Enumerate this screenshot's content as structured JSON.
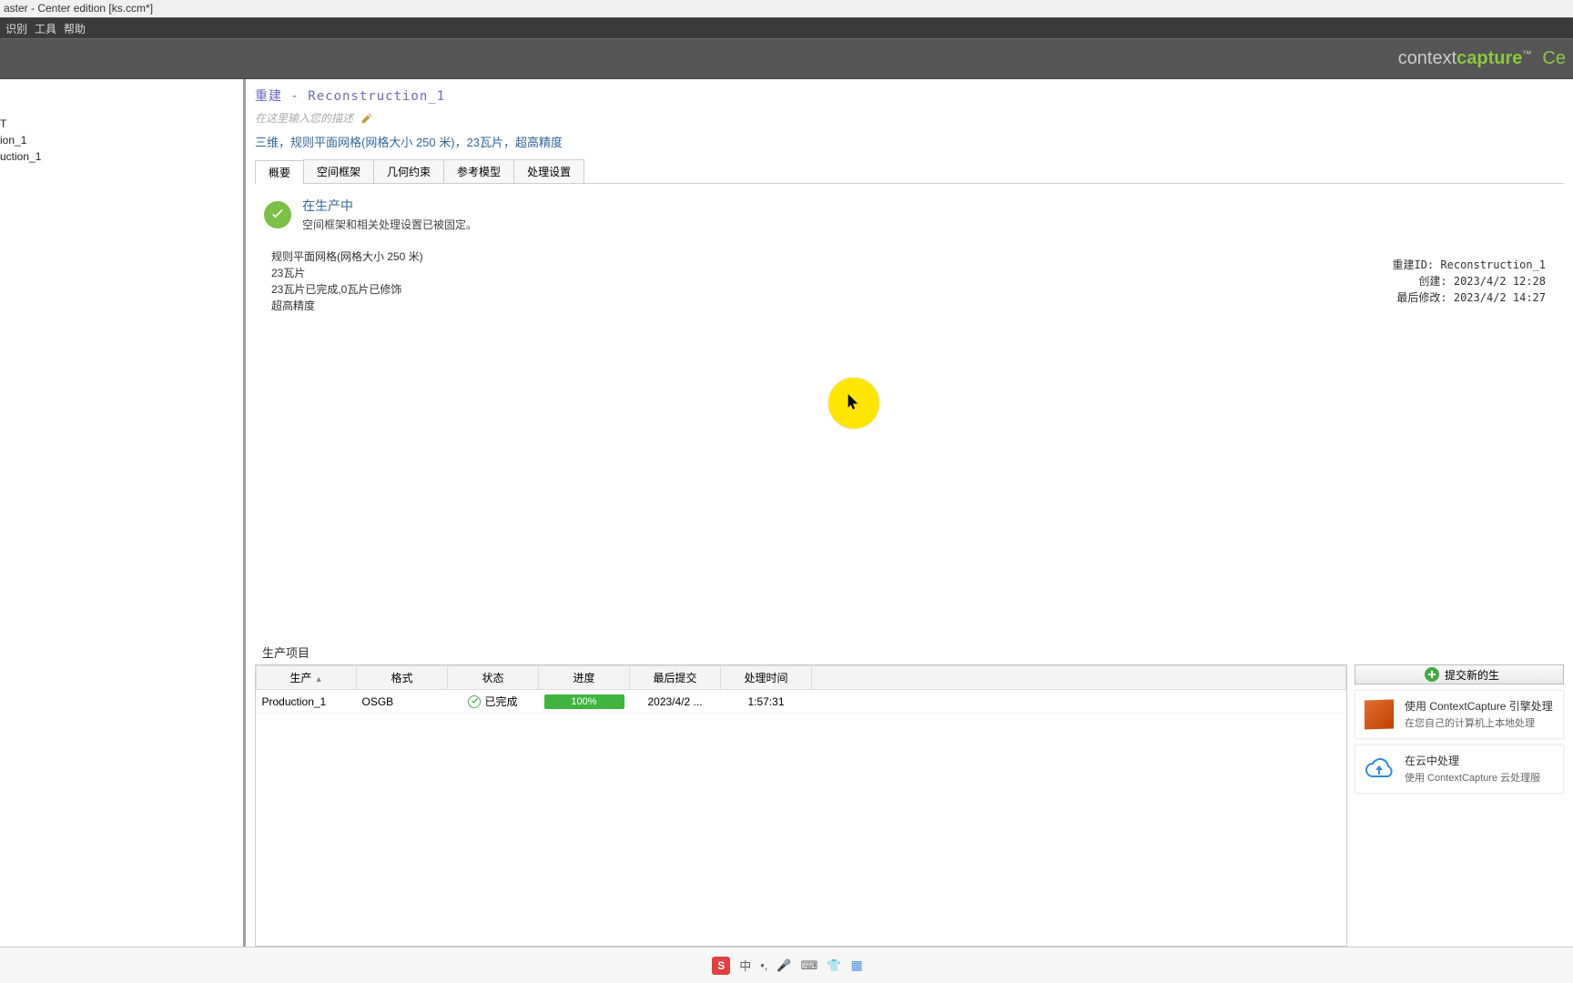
{
  "window": {
    "title": "aster - Center edition [ks.ccm*]"
  },
  "menu": {
    "recognize": "识别",
    "tools": "工具",
    "help": "帮助"
  },
  "brand": {
    "pre": "context",
    "bold": "capture",
    "tm": "™",
    "extra": "Ce"
  },
  "tree": {
    "root": "T",
    "block": "ion_1",
    "recon": "uction_1"
  },
  "page": {
    "title": "重建 - Reconstruction_1",
    "desc_placeholder": "在这里输入您的描述",
    "summary": "三维，规则平面网格(网格大小 250 米)，23瓦片，超高精度"
  },
  "tabs": {
    "overview": "概要",
    "spatial": "空间框架",
    "geom": "几何约束",
    "refmodel": "参考模型",
    "procset": "处理设置"
  },
  "status": {
    "title": "在生产中",
    "sub": "空间框架和相关处理设置已被固定。",
    "d1": "规则平面网格(网格大小 250 米)",
    "d2": "23瓦片",
    "d3": "23瓦片已完成,0瓦片已修饰",
    "d4": "超高精度"
  },
  "meta": {
    "id_label": "重建ID:",
    "id_val": "Reconstruction_1",
    "created_label": "创建:",
    "created_val": "2023/4/2 12:28",
    "mod_label": "最后修改:",
    "mod_val": "2023/4/2 14:27"
  },
  "productions": {
    "section_title": "生产项目",
    "columns": {
      "prod": "生产",
      "fmt": "格式",
      "state": "状态",
      "progress": "进度",
      "last_submit": "最后提交",
      "proc_time": "处理时间"
    },
    "rows": [
      {
        "name": "Production_1",
        "format": "OSGB",
        "status": "已完成",
        "progress": "100%",
        "last_submit": "2023/4/2 ...",
        "proc_time": "1:57:31"
      }
    ]
  },
  "side": {
    "submit": "提交新的生",
    "engine_t1": "使用 ContextCapture 引擎处理",
    "engine_t2": "在您自己的计算机上本地处理",
    "cloud_t1": "在云中处理",
    "cloud_t2": "使用 ContextCapture 云处理服"
  },
  "taskbar": {
    "ime_badge": "S",
    "lang": "中"
  }
}
